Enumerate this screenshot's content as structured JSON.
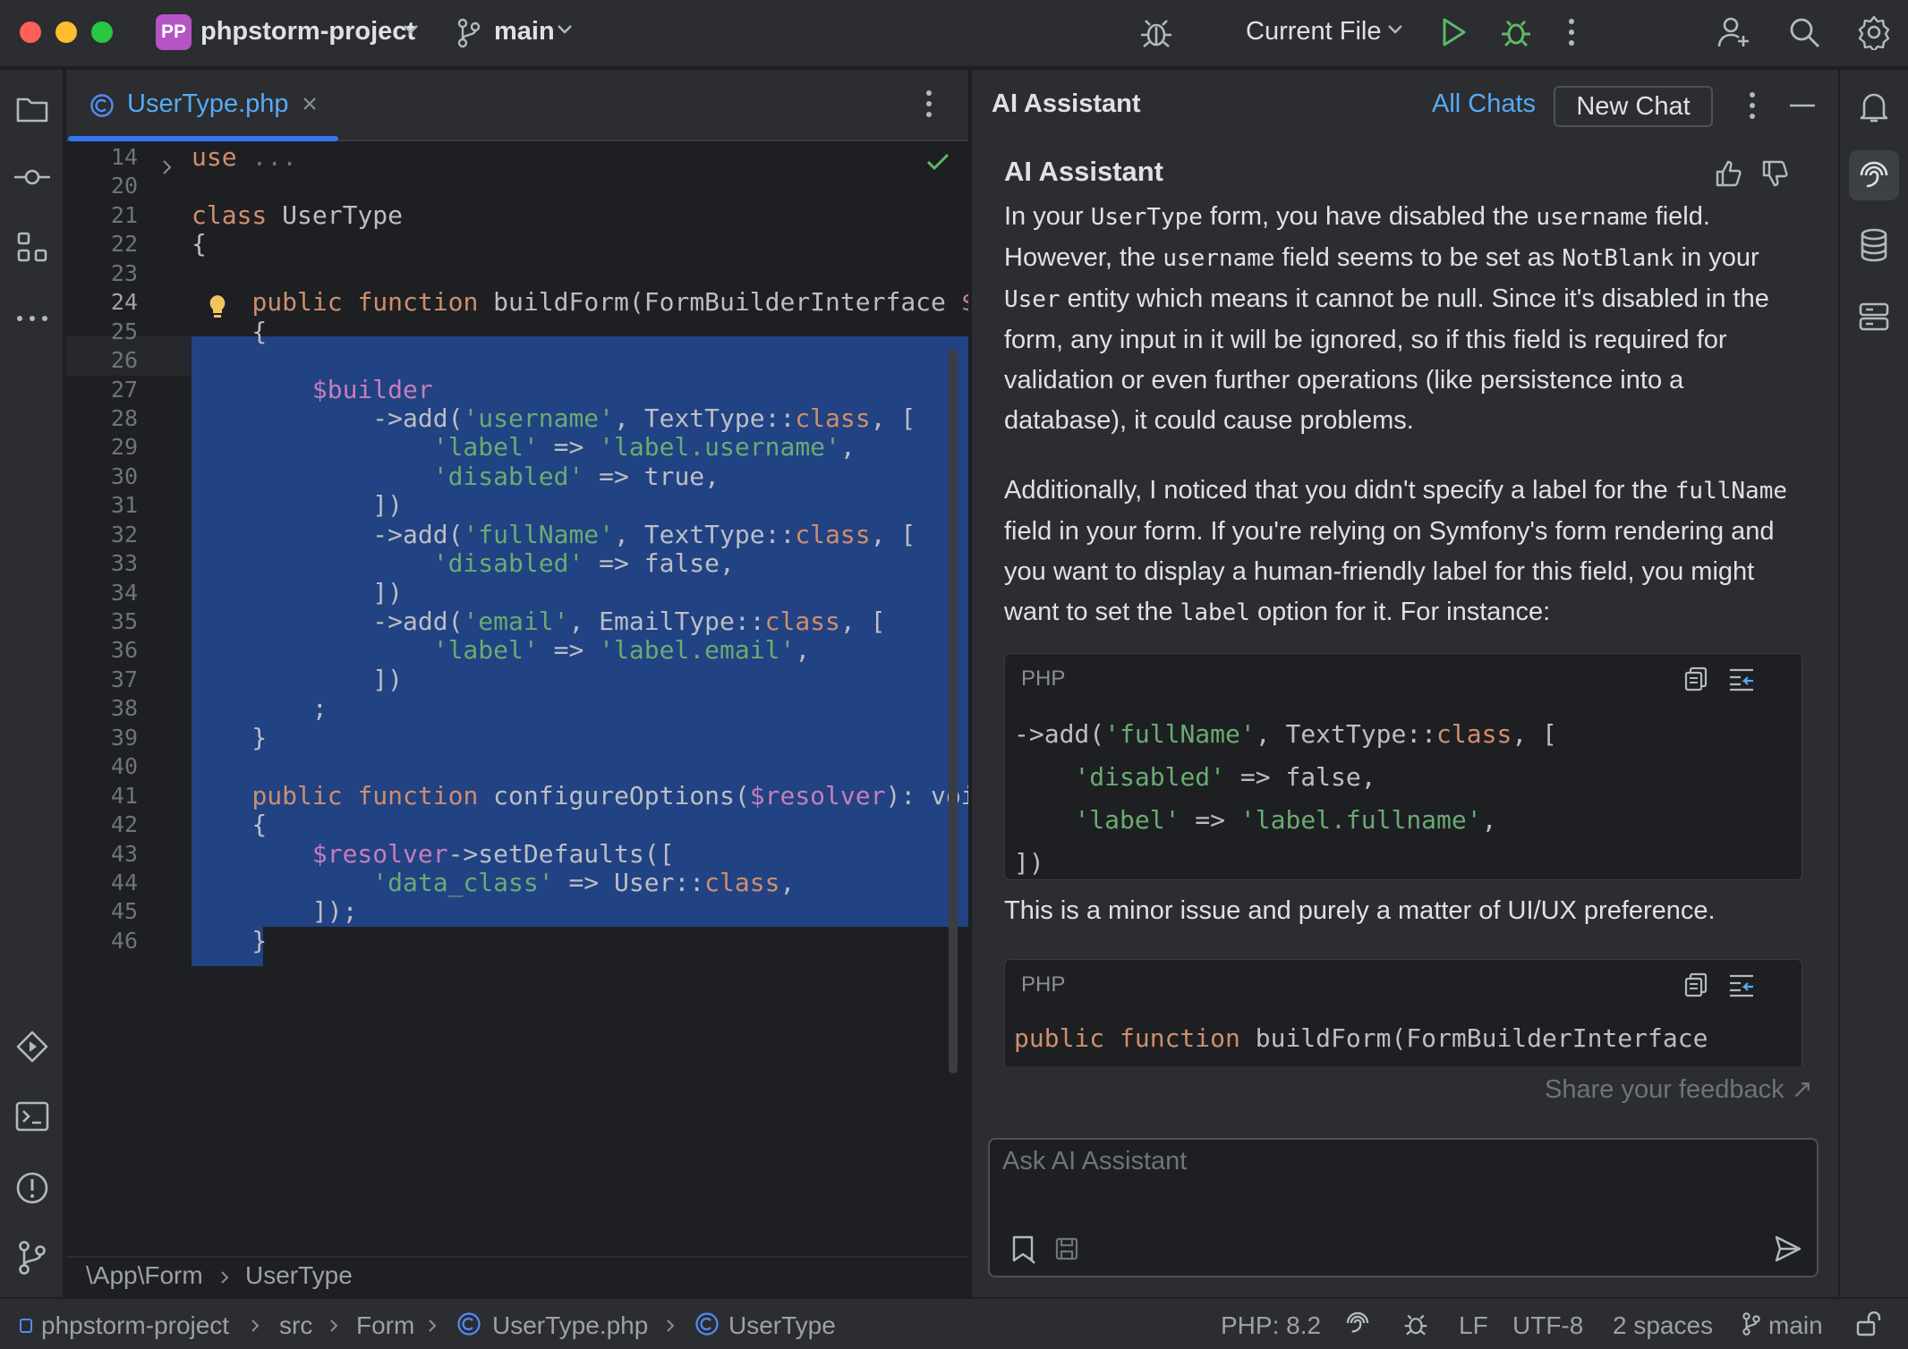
{
  "titlebar": {
    "project_badge": "PP",
    "project_name": "phpstorm-project",
    "branch": "main",
    "run_config": "Current File"
  },
  "editor": {
    "tab_label": "UserType.php",
    "breadcrumb": [
      "\\App\\Form",
      "UserType"
    ],
    "lines": [
      {
        "n": "14",
        "tokens": [
          {
            "t": "use",
            "c": "kw"
          },
          {
            "t": " ",
            "c": ""
          },
          {
            "t": "...",
            "c": "dim"
          }
        ]
      },
      {
        "n": "20",
        "tokens": []
      },
      {
        "n": "21",
        "tokens": [
          {
            "t": "class",
            "c": "kw"
          },
          {
            "t": " UserType",
            "c": ""
          }
        ]
      },
      {
        "n": "22",
        "tokens": [
          {
            "t": "{",
            "c": ""
          }
        ]
      },
      {
        "n": "23",
        "tokens": []
      },
      {
        "n": "24",
        "tokens": [
          {
            "t": "    ",
            "c": ""
          },
          {
            "t": "public function",
            "c": "kw"
          },
          {
            "t": " buildForm(FormBuilderInterface ",
            "c": ""
          },
          {
            "t": "$builder",
            "c": "var"
          }
        ]
      },
      {
        "n": "25",
        "tokens": [
          {
            "t": "    {",
            "c": ""
          }
        ]
      },
      {
        "n": "26",
        "tokens": []
      },
      {
        "n": "27",
        "tokens": [
          {
            "t": "        ",
            "c": ""
          },
          {
            "t": "$builder",
            "c": "var"
          }
        ]
      },
      {
        "n": "28",
        "tokens": [
          {
            "t": "            ->add(",
            "c": ""
          },
          {
            "t": "'username'",
            "c": "str"
          },
          {
            "t": ", TextType::",
            "c": ""
          },
          {
            "t": "class",
            "c": "kw"
          },
          {
            "t": ", [",
            "c": ""
          }
        ]
      },
      {
        "n": "29",
        "tokens": [
          {
            "t": "                ",
            "c": ""
          },
          {
            "t": "'label'",
            "c": "str"
          },
          {
            "t": " => ",
            "c": ""
          },
          {
            "t": "'label.username'",
            "c": "str"
          },
          {
            "t": ",",
            "c": ""
          }
        ]
      },
      {
        "n": "30",
        "tokens": [
          {
            "t": "                ",
            "c": ""
          },
          {
            "t": "'disabled'",
            "c": "str"
          },
          {
            "t": " => true,",
            "c": ""
          }
        ]
      },
      {
        "n": "31",
        "tokens": [
          {
            "t": "            ])",
            "c": ""
          }
        ]
      },
      {
        "n": "32",
        "tokens": [
          {
            "t": "            ->add(",
            "c": ""
          },
          {
            "t": "'fullName'",
            "c": "str"
          },
          {
            "t": ", TextType::",
            "c": ""
          },
          {
            "t": "class",
            "c": "kw"
          },
          {
            "t": ", [",
            "c": ""
          }
        ]
      },
      {
        "n": "33",
        "tokens": [
          {
            "t": "                ",
            "c": ""
          },
          {
            "t": "'disabled'",
            "c": "str"
          },
          {
            "t": " => false,",
            "c": ""
          }
        ]
      },
      {
        "n": "34",
        "tokens": [
          {
            "t": "            ])",
            "c": ""
          }
        ]
      },
      {
        "n": "35",
        "tokens": [
          {
            "t": "            ->add(",
            "c": ""
          },
          {
            "t": "'email'",
            "c": "str"
          },
          {
            "t": ", EmailType::",
            "c": ""
          },
          {
            "t": "class",
            "c": "kw"
          },
          {
            "t": ", [",
            "c": ""
          }
        ]
      },
      {
        "n": "36",
        "tokens": [
          {
            "t": "                ",
            "c": ""
          },
          {
            "t": "'label'",
            "c": "str"
          },
          {
            "t": " => ",
            "c": ""
          },
          {
            "t": "'label.email'",
            "c": "str"
          },
          {
            "t": ",",
            "c": ""
          }
        ]
      },
      {
        "n": "37",
        "tokens": [
          {
            "t": "            ])",
            "c": ""
          }
        ]
      },
      {
        "n": "38",
        "tokens": [
          {
            "t": "        ;",
            "c": ""
          }
        ]
      },
      {
        "n": "39",
        "tokens": [
          {
            "t": "    }",
            "c": ""
          }
        ]
      },
      {
        "n": "40",
        "tokens": []
      },
      {
        "n": "41",
        "tokens": [
          {
            "t": "    ",
            "c": ""
          },
          {
            "t": "public function",
            "c": "kw"
          },
          {
            "t": " configureOptions(",
            "c": ""
          },
          {
            "t": "$resolver",
            "c": "var"
          },
          {
            "t": "): void",
            "c": ""
          }
        ]
      },
      {
        "n": "42",
        "tokens": [
          {
            "t": "    {",
            "c": ""
          }
        ]
      },
      {
        "n": "43",
        "tokens": [
          {
            "t": "        ",
            "c": ""
          },
          {
            "t": "$resolver",
            "c": "var"
          },
          {
            "t": "->setDefaults([",
            "c": ""
          }
        ]
      },
      {
        "n": "44",
        "tokens": [
          {
            "t": "            ",
            "c": ""
          },
          {
            "t": "'data_class'",
            "c": "str"
          },
          {
            "t": " => User::",
            "c": ""
          },
          {
            "t": "class",
            "c": "kw"
          },
          {
            "t": ",",
            "c": ""
          }
        ]
      },
      {
        "n": "45",
        "tokens": [
          {
            "t": "        ]);",
            "c": ""
          }
        ]
      },
      {
        "n": "46",
        "tokens": [
          {
            "t": "    }",
            "c": ""
          }
        ]
      }
    ]
  },
  "ai": {
    "panel_title": "AI Assistant",
    "all_chats": "All Chats",
    "new_chat": "New Chat",
    "message_author": "AI Assistant",
    "para1": [
      {
        "t": "In your ",
        "m": false
      },
      {
        "t": "UserType",
        "m": true
      },
      {
        "t": " form, you have disabled the ",
        "m": false
      },
      {
        "t": "username",
        "m": true
      },
      {
        "t": " field. However, the ",
        "m": false
      },
      {
        "t": "username",
        "m": true
      },
      {
        "t": " field seems to be set as ",
        "m": false
      },
      {
        "t": "NotBlank",
        "m": true
      },
      {
        "t": " in your ",
        "m": false
      },
      {
        "t": "User",
        "m": true
      },
      {
        "t": " entity which means it cannot be null. Since it's disabled in the form, any input in it will be ignored, so if this field is required for validation or even further operations (like persistence into a database), it could cause problems.",
        "m": false
      }
    ],
    "para2": [
      {
        "t": "Additionally, I noticed that you didn't specify a label for the ",
        "m": false
      },
      {
        "t": "fullName",
        "m": true
      },
      {
        "t": " field in your form. If you're relying on Symfony's form rendering and you want to display a human-friendly label for this field, you might want to set the ",
        "m": false
      },
      {
        "t": "label",
        "m": true
      },
      {
        "t": " option for it. For instance:",
        "m": false
      }
    ],
    "code1_lang": "PHP",
    "code1_lines": [
      [
        {
          "t": "->add(",
          "c": ""
        },
        {
          "t": "'fullName'",
          "c": "str"
        },
        {
          "t": ", TextType::",
          "c": ""
        },
        {
          "t": "class",
          "c": "kw"
        },
        {
          "t": ", [",
          "c": ""
        }
      ],
      [
        {
          "t": "    ",
          "c": ""
        },
        {
          "t": "'disabled'",
          "c": "str"
        },
        {
          "t": " => false,",
          "c": ""
        }
      ],
      [
        {
          "t": "    ",
          "c": ""
        },
        {
          "t": "'label'",
          "c": "str"
        },
        {
          "t": " => ",
          "c": ""
        },
        {
          "t": "'label.fullname'",
          "c": "str"
        },
        {
          "t": ",",
          "c": ""
        }
      ],
      [
        {
          "t": "])",
          "c": ""
        }
      ]
    ],
    "para3": "This is a minor issue and purely a matter of UI/UX preference.",
    "code2_lang": "PHP",
    "code2_lines": [
      [
        {
          "t": "public function",
          "c": "kw"
        },
        {
          "t": " buildForm(FormBuilderInterface",
          "c": ""
        }
      ]
    ],
    "feedback_link": "Share your feedback ↗",
    "input_placeholder": "Ask AI Assistant"
  },
  "statusbar": {
    "path": [
      "phpstorm-project",
      "src",
      "Form",
      "UserType.php",
      "UserType"
    ],
    "php_version": "PHP: 8.2",
    "line_ending": "LF",
    "encoding": "UTF-8",
    "indent": "2 spaces",
    "branch": "main"
  },
  "colors": {
    "accent": "#3574f0",
    "selection": "#214283",
    "keyword": "#cf8e6d",
    "string": "#6aab73",
    "variable": "#c77dbb",
    "link": "#57aaf7"
  },
  "icons": [
    "folder-icon",
    "commit-icon",
    "structure-icon",
    "more-icon",
    "services-icon",
    "terminal-icon",
    "problems-icon",
    "git-icon",
    "bell-icon",
    "ai-icon",
    "database-icon",
    "server-icon",
    "debug-icon",
    "run-icon",
    "search-icon",
    "settings-icon",
    "add-user-icon",
    "copy-icon",
    "insert-icon",
    "send-icon",
    "thumbs-up-icon",
    "thumbs-down-icon"
  ]
}
